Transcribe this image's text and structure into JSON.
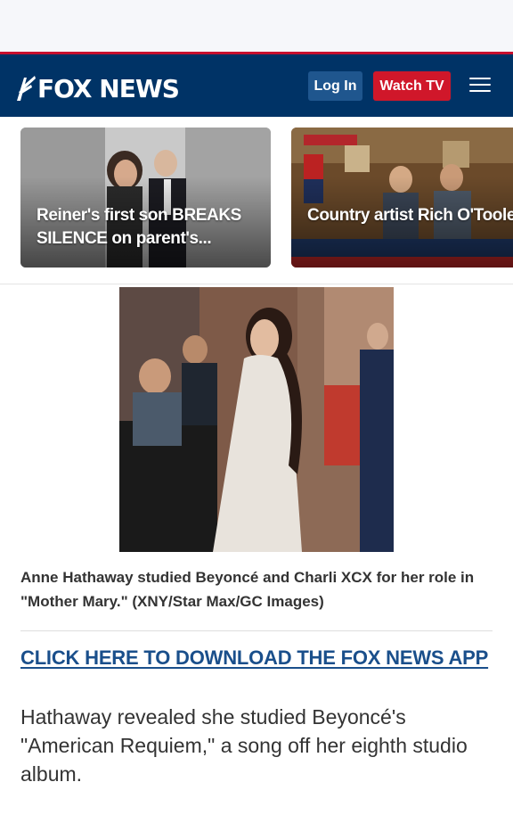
{
  "header": {
    "logo_text": "FOX NEWS",
    "login_label": "Log In",
    "watch_label": "Watch TV",
    "menu_icon": "hamburger-menu-icon"
  },
  "promo": [
    {
      "title": "Reiner's first son BREAKS SILENCE on parent's..."
    },
    {
      "title": "Country artist Rich O'Toole joins 'Fox & Friends' in..."
    }
  ],
  "article": {
    "image_caption": "Anne Hathaway studied Beyoncé and Charli XCX for her role in \"Mother Mary.\" (XNY/Star Max/GC Images)",
    "cta_link": "CLICK HERE TO DOWNLOAD THE FOX NEWS APP",
    "paragraph": "Hathaway revealed she studied Beyoncé's \"American Requiem,\" a song off her eighth studio album."
  },
  "colors": {
    "header_bg": "#003366",
    "accent_red": "#d0172a",
    "login_bg": "#1f568e",
    "link": "#1a4f8b"
  }
}
